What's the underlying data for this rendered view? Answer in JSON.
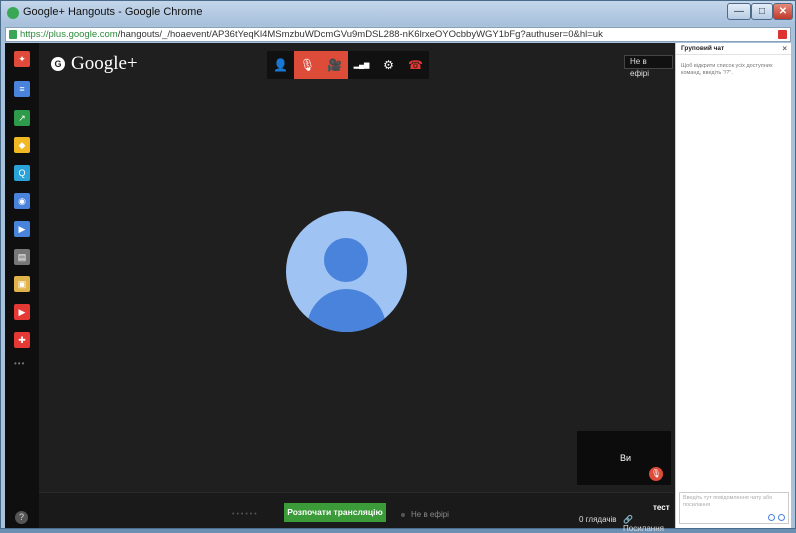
{
  "window": {
    "title": "Google+ Hangouts - Google Chrome",
    "min_label": "—",
    "max_label": "□",
    "close_label": "✕"
  },
  "urlbar": {
    "scheme_host": "https://plus.google.com",
    "path": "/hangouts/_/hoaevent/AP36tYeqKl4MSmzbuWDcmGVu9mDSL288-nK6lrxeOYOcbbyWGY1bFg?authuser=0&hl=uk"
  },
  "sidebar": {
    "apps": [
      {
        "name": "hangouts-app",
        "color": "#e04a3a",
        "glyph": "✦"
      },
      {
        "name": "chat-app",
        "color": "#4a83dc",
        "glyph": "≡"
      },
      {
        "name": "screenshare-app",
        "color": "#2e9b4a",
        "glyph": "↗"
      },
      {
        "name": "effects-app",
        "color": "#f2b824",
        "glyph": "◆"
      },
      {
        "name": "qa-app",
        "color": "#2aa3d9",
        "glyph": "Q"
      },
      {
        "name": "capture-app",
        "color": "#4a83dc",
        "glyph": "◉"
      },
      {
        "name": "control-room-app",
        "color": "#4a83dc",
        "glyph": "▶"
      },
      {
        "name": "lower-third-app",
        "color": "#777777",
        "glyph": "▤"
      },
      {
        "name": "showcase-app",
        "color": "#e0b24a",
        "glyph": "▣"
      },
      {
        "name": "youtube-app",
        "color": "#e53935",
        "glyph": "▶"
      },
      {
        "name": "help-app",
        "color": "#e53935",
        "glyph": "✚"
      }
    ],
    "more_label": "•••",
    "help_label": "?"
  },
  "stage": {
    "logo_text": "Google+",
    "logo_bubble": "G",
    "onair_button": "Не в ефірі",
    "toolbar": [
      {
        "name": "invite-people-button",
        "glyph": "👤",
        "active": false
      },
      {
        "name": "mute-mic-button",
        "glyph": "🎙",
        "active": true
      },
      {
        "name": "camera-off-button",
        "glyph": "🎥",
        "active": true
      },
      {
        "name": "bandwidth-button",
        "glyph": "▂▄▆",
        "active": false
      },
      {
        "name": "settings-button",
        "glyph": "⚙",
        "active": false
      },
      {
        "name": "leave-call-button",
        "glyph": "☎",
        "active": false
      }
    ],
    "self_label": "Ви",
    "self_mic_glyph": "🎙"
  },
  "bottombar": {
    "dots": "••••••",
    "broadcast_button": "Розпочати трансляцію",
    "offair_status": "Не в ефірі",
    "event_title": "тест",
    "viewers": "0 глядачів",
    "links": "🔗 Посилання"
  },
  "chat": {
    "title": "Груповий чат",
    "close_label": "×",
    "hint": "Щоб відкрити список усіх доступних команд, введіть \"/?\".",
    "input_placeholder": "Введіть тут повідомлення чату або посилання"
  },
  "colors": {
    "accent_red": "#dd4b39",
    "broadcast_green": "#3a9b38",
    "avatar_blue": "#4a83dc"
  }
}
